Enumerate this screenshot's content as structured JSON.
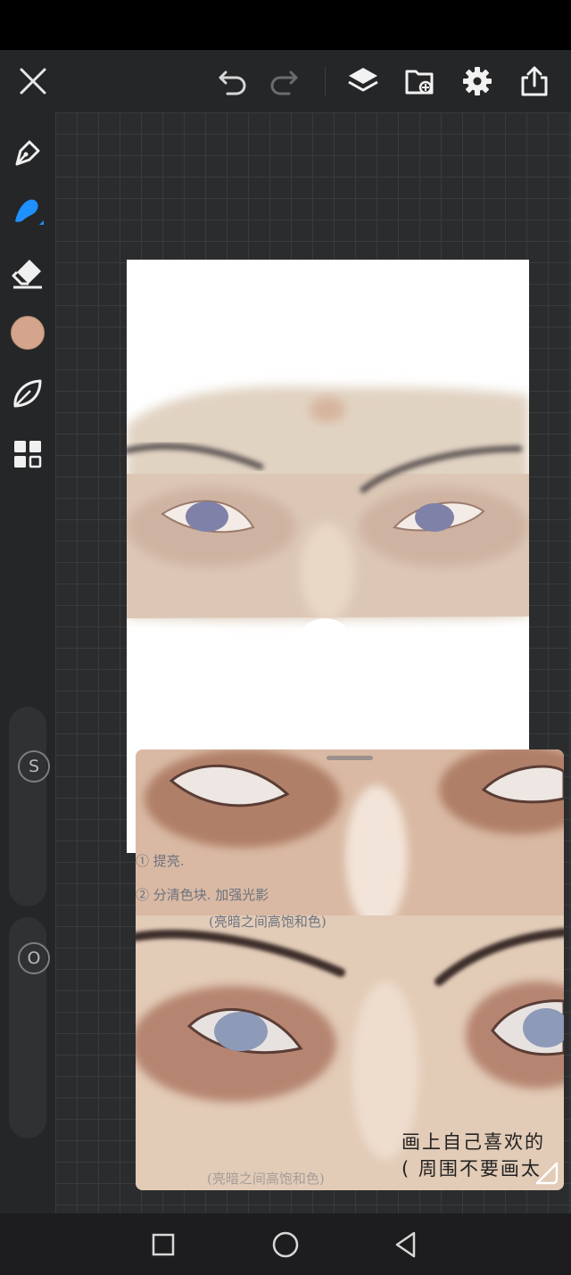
{
  "toolbar": {
    "buttons": [
      "close-icon",
      "undo-icon",
      "redo-icon",
      "layers-icon",
      "import-icon",
      "settings-icon",
      "share-icon"
    ]
  },
  "sidebar": {
    "tools": [
      "pen-tool-icon",
      "brush-tool-icon",
      "eraser-tool-icon",
      "color-swatch",
      "smudge-tool-icon",
      "gallery-icon"
    ],
    "active_tool": "brush-tool-icon",
    "color": "#d4a58c",
    "accent_color": "#1e90ff",
    "size_slider_label": "S",
    "opacity_slider_label": "O"
  },
  "reference_panel": {
    "notes": {
      "line1": "① 提亮.",
      "line2": "② 分清色块. 加强光影",
      "line3": "(亮暗之间高饱和色)",
      "line4": "(亮暗之间高饱和色)"
    },
    "caption_line1": "画上自己喜欢的",
    "caption_line2": "( 周围不要画太"
  },
  "navigation": {
    "buttons": [
      "recent-apps-icon",
      "home-icon",
      "back-icon"
    ]
  }
}
